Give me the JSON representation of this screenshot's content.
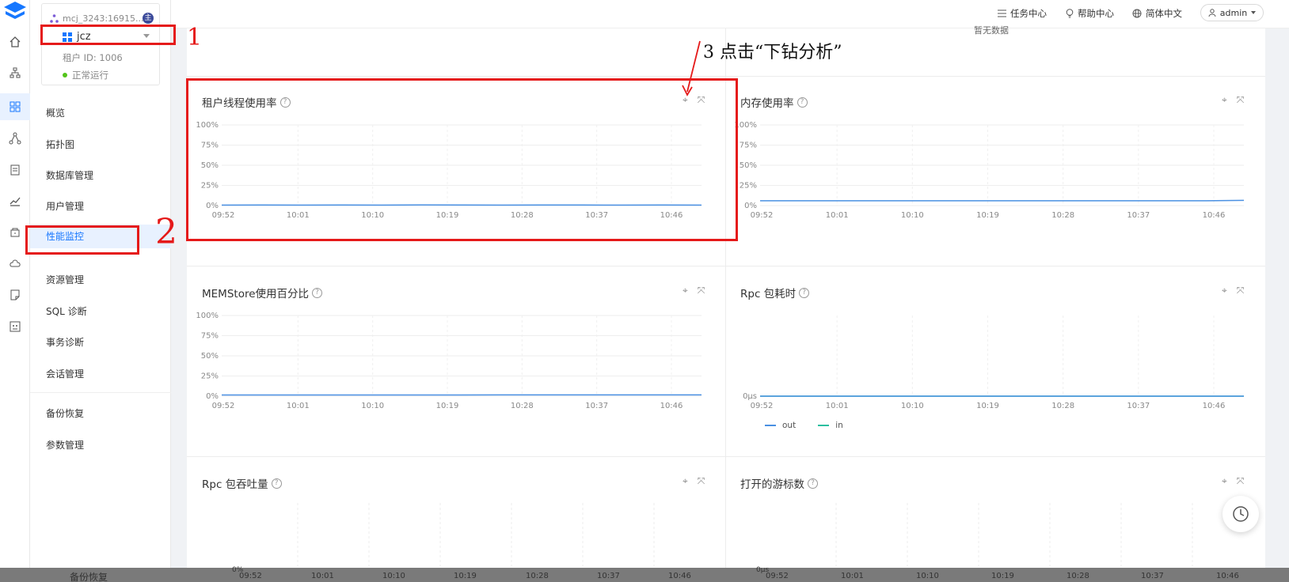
{
  "tenant": {
    "path": "mcj_3243:16915...",
    "badge": "主",
    "name": "jcz",
    "id_label": "租户 ID: 1006",
    "status": "正常运行"
  },
  "nav": {
    "items": [
      "概览",
      "拓扑图",
      "数据库管理",
      "用户管理",
      "性能监控",
      "资源管理",
      "SQL 诊断",
      "事务诊断",
      "会话管理",
      "备份恢复",
      "参数管理"
    ],
    "active": "性能监控"
  },
  "topbar": {
    "tasks": "任务中心",
    "help": "帮助中心",
    "lang": "简体中文",
    "user": "admin"
  },
  "top_partial": "暂无数据",
  "panels": {
    "p1": {
      "title": "租户线程使用率"
    },
    "p2": {
      "title": "内存使用率"
    },
    "p3": {
      "title": "MEMStore使用百分比"
    },
    "p4": {
      "title": "Rpc 包耗时"
    },
    "p5": {
      "title": "Rpc 包吞吐量"
    },
    "p6": {
      "title": "打开的游标数"
    }
  },
  "chart_data": [
    {
      "type": "line",
      "title": "租户线程使用率",
      "y_ticks": [
        "100%",
        "75%",
        "50%",
        "25%",
        "0%"
      ],
      "ylim": [
        0,
        100
      ],
      "x_ticks": [
        "09:52",
        "10:01",
        "10:10",
        "10:19",
        "10:28",
        "10:37",
        "10:46"
      ],
      "series": [
        {
          "values": [
            0.6,
            0.7,
            0.6,
            0.8,
            0.6,
            0.9,
            0.7,
            0.6,
            0.8,
            0.7,
            0.6,
            0.7,
            0.6
          ]
        }
      ]
    },
    {
      "type": "line",
      "title": "内存使用率",
      "y_ticks": [
        "100%",
        "75%",
        "50%",
        "25%",
        "0%"
      ],
      "ylim": [
        0,
        100
      ],
      "x_ticks": [
        "09:52",
        "10:01",
        "10:10",
        "10:19",
        "10:28",
        "10:37",
        "10:46"
      ],
      "series": [
        {
          "values": [
            6,
            6,
            6,
            6,
            6,
            6,
            6,
            6,
            6,
            6,
            6,
            6,
            6.5
          ]
        }
      ]
    },
    {
      "type": "line",
      "title": "MEMStore使用百分比",
      "y_ticks": [
        "100%",
        "75%",
        "50%",
        "25%",
        "0%"
      ],
      "ylim": [
        0,
        100
      ],
      "x_ticks": [
        "09:52",
        "10:01",
        "10:10",
        "10:19",
        "10:28",
        "10:37",
        "10:46"
      ],
      "series": [
        {
          "values": [
            1.5,
            1.5,
            1.5,
            1.5,
            1.5,
            1.5,
            1.5,
            1.6,
            1.6,
            1.6,
            1.6,
            1.6,
            1.6
          ]
        }
      ]
    },
    {
      "type": "line",
      "title": "Rpc 包耗时",
      "y_ticks": [
        "0μs"
      ],
      "x_ticks": [
        "09:52",
        "10:01",
        "10:10",
        "10:19",
        "10:28",
        "10:37",
        "10:46"
      ],
      "legend": [
        "out",
        "in"
      ],
      "series": [
        {
          "name": "out",
          "values": [
            0,
            0,
            0,
            0,
            0,
            0,
            0,
            0,
            0,
            0,
            0,
            0,
            0
          ]
        },
        {
          "name": "in",
          "values": [
            0,
            0,
            0,
            0,
            0,
            0,
            0,
            0,
            0,
            0,
            0,
            0,
            0
          ]
        }
      ]
    }
  ],
  "bottom": {
    "left_label": "备份恢复",
    "y_left": "0%",
    "y_right": "0μs",
    "x_ticks": [
      "09:52",
      "10:01",
      "10:10",
      "10:19",
      "10:28",
      "10:37",
      "10:46"
    ]
  },
  "annotations": {
    "n1": "1",
    "n2": "2",
    "n3": "3 点击“下钻分析”"
  },
  "colors": {
    "accent": "#1677ff",
    "line": "#4a90e2",
    "in_line": "#2bbf9f",
    "annotation": "#e51a1a"
  }
}
